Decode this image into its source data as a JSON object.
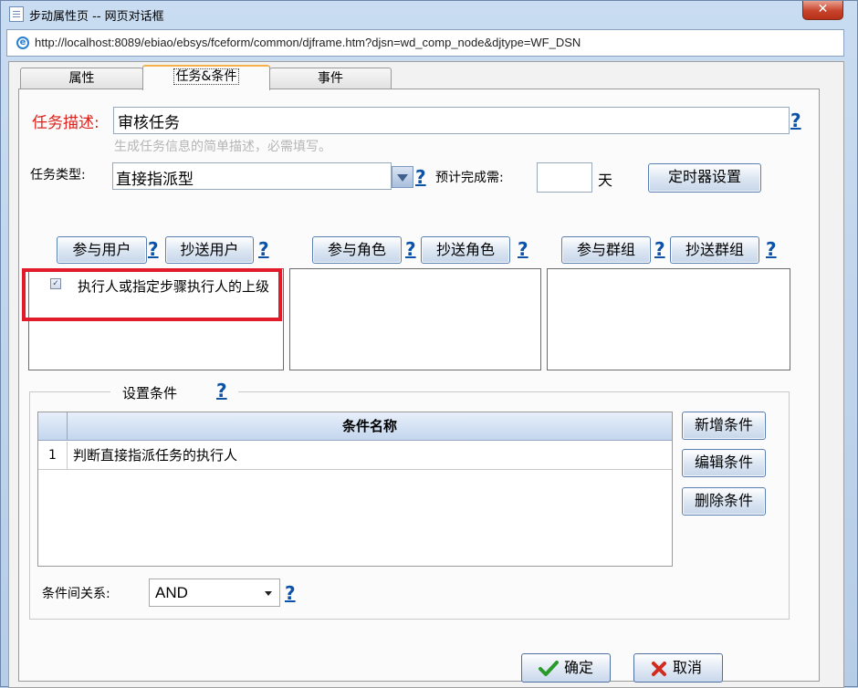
{
  "window": {
    "title": "步动属性页 -- 网页对话框",
    "close_label": "✕",
    "url": "http://localhost:8089/ebiao/ebsys/fceform/common/djframe.htm?djsn=wd_comp_node&djtype=WF_DSN"
  },
  "tabs": [
    {
      "label": "属性"
    },
    {
      "label": "任务&条件"
    },
    {
      "label": "事件"
    }
  ],
  "task": {
    "desc_label": "任务描述:",
    "desc_value": "审核任务",
    "desc_hint": "生成任务信息的简单描述，必需填写。",
    "type_label": "任务类型:",
    "type_value": "直接指派型",
    "estimate_label": "预计完成需:",
    "estimate_value": "",
    "estimate_unit": "天",
    "timer_button": "定时器设置"
  },
  "help_mark": "?",
  "participants": {
    "user_button": "参与用户",
    "cc_user_button": "抄送用户",
    "role_button": "参与角色",
    "cc_role_button": "抄送角色",
    "group_button": "参与群组",
    "cc_group_button": "抄送群组",
    "user_list": [
      {
        "checked": true,
        "check_mark": "✓",
        "label": "执行人或指定步骤执行人的上级"
      }
    ]
  },
  "conditions": {
    "legend": "设置条件",
    "column_header": "条件名称",
    "rows": [
      {
        "num": "1",
        "name": "判断直接指派任务的执行人"
      }
    ],
    "add_button": "新增条件",
    "edit_button": "编辑条件",
    "delete_button": "删除条件",
    "relation_label": "条件间关系:",
    "relation_value": "AND"
  },
  "footer": {
    "ok_label": "确定",
    "cancel_label": "取消",
    "ok_icon_color": "#2a9a2a",
    "cancel_icon_color": "#d12a1f"
  }
}
